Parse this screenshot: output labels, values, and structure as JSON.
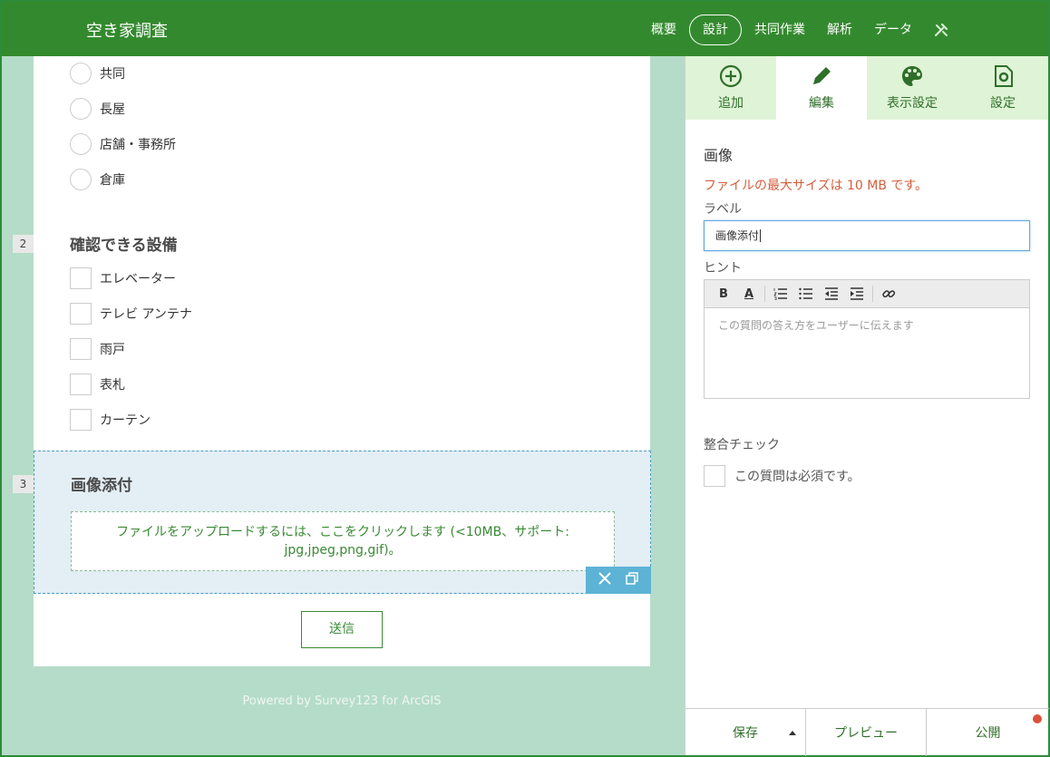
{
  "app": {
    "title": "空き家調査"
  },
  "nav": {
    "items": [
      {
        "label": "概要",
        "active": false
      },
      {
        "label": "設計",
        "active": true
      },
      {
        "label": "共同作業",
        "active": false
      },
      {
        "label": "解析",
        "active": false
      },
      {
        "label": "データ",
        "active": false
      }
    ],
    "tool_icon": "tools-icon"
  },
  "form": {
    "q1_options": [
      "共同",
      "長屋",
      "店舗・事務所",
      "倉庫"
    ],
    "q2": {
      "number": "2",
      "title": "確認できる設備",
      "options": [
        "エレベーター",
        " テレビ アンテナ",
        "雨戸",
        "表札",
        "カーテン"
      ]
    },
    "q3": {
      "number": "3",
      "title": "画像添付",
      "upload_text_line1": "ファイルをアップロードするには、ここをクリックします (<10MB、サポート:",
      "upload_text_line2": "jpg,jpeg,png,gif)。"
    },
    "submit_label": "送信",
    "powered_by": "Powered by Survey123 for ArcGIS"
  },
  "panel": {
    "tabs": [
      {
        "label": "追加",
        "icon": "plus-circle-icon",
        "active": false
      },
      {
        "label": "編集",
        "icon": "pencil-icon",
        "active": true
      },
      {
        "label": "表示設定",
        "icon": "palette-icon",
        "active": false
      },
      {
        "label": "設定",
        "icon": "settings-doc-icon",
        "active": false
      }
    ],
    "title": "画像",
    "warning": "ファイルの最大サイズは 10 MB です。",
    "label_field_label": "ラベル",
    "label_value": "画像添付",
    "hint_label": "ヒント",
    "hint_placeholder": "この質問の答え方をユーザーに伝えます",
    "validation_label": "整合チェック",
    "required_label": "この質問は必須です。",
    "footer": {
      "save": "保存",
      "preview": "プレビュー",
      "publish": "公開"
    }
  },
  "colors": {
    "header": "#338a2e",
    "canvas_bg": "#b5dcc9",
    "tab_bg": "#dff4d6",
    "warning": "#d35e3c",
    "accent_blue": "#5cb3d6"
  }
}
